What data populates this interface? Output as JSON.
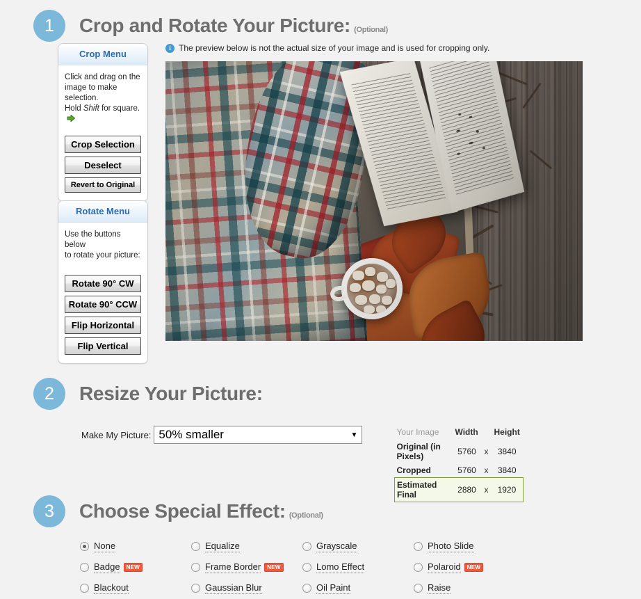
{
  "steps": [
    {
      "number": "1",
      "title": "Crop and Rotate Your Picture:",
      "optional": "(Optional)"
    },
    {
      "number": "2",
      "title": "Resize Your Picture:",
      "optional": ""
    },
    {
      "number": "3",
      "title": "Choose Special Effect:",
      "optional": "(Optional)"
    }
  ],
  "notice": {
    "icon": "info-icon",
    "text": "The preview below is not the actual size of your image and is used for cropping only."
  },
  "crop_menu": {
    "title": "Crop Menu",
    "instruction_line1": "Click and drag on the",
    "instruction_line2": "image to make selection.",
    "instruction_line3_pre": "Hold ",
    "instruction_line3_em": "Shift",
    "instruction_line3_post": " for square.",
    "arrow_icon": "green-arrow-right-icon",
    "buttons": [
      {
        "label": "Crop Selection",
        "size": "s13"
      },
      {
        "label": "Deselect",
        "size": "s13"
      },
      {
        "label": "Revert to Original",
        "size": "s11"
      }
    ]
  },
  "rotate_menu": {
    "title": "Rotate Menu",
    "instruction_line1": "Use the buttons below",
    "instruction_line2": "to rotate your picture:",
    "buttons": [
      {
        "label": "Rotate 90° CW",
        "size": "s13"
      },
      {
        "label": "Rotate 90° CCW",
        "size": "s13"
      },
      {
        "label": "Flip Horizontal",
        "size": "s13"
      },
      {
        "label": "Flip Vertical",
        "size": "s13"
      }
    ]
  },
  "preview": {
    "alt": "Flat-lay photo of a plaid blanket, an open book, and a mug of hot cocoa with marshmallows on a wooden tray with autumn leaves over weathered wood planks"
  },
  "resize": {
    "label": "Make My Picture:",
    "selected": "50% smaller",
    "dropdown_icon": "chevron-down-icon"
  },
  "dimensions": {
    "headers": [
      "Your Image",
      "Width",
      "",
      "Height"
    ],
    "rows": [
      {
        "label": "Original (in Pixels)",
        "width": "5760",
        "x": "x",
        "height": "3840",
        "highlight": false
      },
      {
        "label": "Cropped",
        "width": "5760",
        "x": "x",
        "height": "3840",
        "highlight": false
      },
      {
        "label": "Estimated Final",
        "width": "2880",
        "x": "x",
        "height": "1920",
        "highlight": true
      }
    ]
  },
  "effects": {
    "selected": "None",
    "options": [
      {
        "label": "None",
        "new": false,
        "checked": true
      },
      {
        "label": "Badge",
        "new": true,
        "checked": false
      },
      {
        "label": "Blackout",
        "new": false,
        "checked": false
      },
      {
        "label": "Equalize",
        "new": false,
        "checked": false
      },
      {
        "label": "Frame Border",
        "new": true,
        "checked": false
      },
      {
        "label": "Gaussian Blur",
        "new": false,
        "checked": false
      },
      {
        "label": "Grayscale",
        "new": false,
        "checked": false
      },
      {
        "label": "Lomo Effect",
        "new": false,
        "checked": false
      },
      {
        "label": "Oil Paint",
        "new": false,
        "checked": false
      },
      {
        "label": "Photo Slide",
        "new": false,
        "checked": false
      },
      {
        "label": "Polaroid",
        "new": true,
        "checked": false
      },
      {
        "label": "Raise",
        "new": false,
        "checked": false
      }
    ],
    "new_badge_text": "NEW"
  },
  "colors": {
    "page_bg": "#f2f2f2",
    "step_circle": "#7bb8d9",
    "step_title": "#6e6e6e",
    "panel_title": "#2b6cb3",
    "new_badge": "#ef5a3d",
    "final_row_border": "#7f9b3a",
    "final_row_bg": "#f3f8e8",
    "info_icon": "#3d9bd6"
  }
}
